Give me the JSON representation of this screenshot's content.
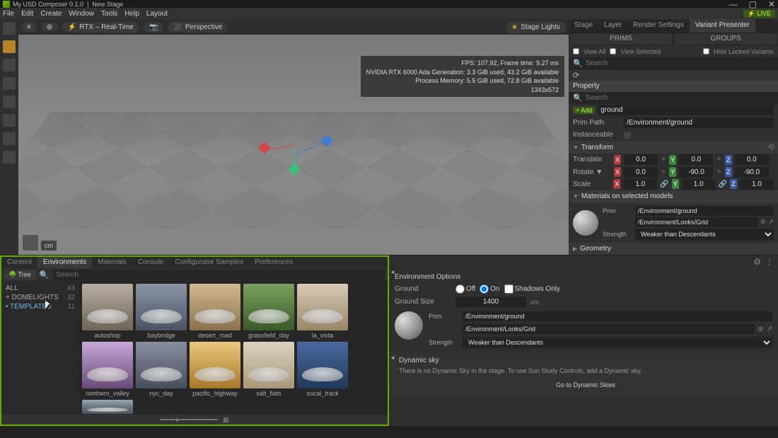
{
  "titlebar": {
    "app": "My USD Composer",
    "version": "0.1.0",
    "stage": "New Stage"
  },
  "menus": [
    "File",
    "Edit",
    "Create",
    "Window",
    "Tools",
    "Help",
    "Layout"
  ],
  "live_label": "LIVE",
  "viewport": {
    "camera_btn": "",
    "rtx_label": "RTX – Real-Time",
    "persp_label": "Perspective",
    "stage_lights": "Stage Lights",
    "stats": {
      "l1": "FPS: 107.92, Frame time: 9.27 ms",
      "l2": "NVIDIA RTX 6000 Ada Generation: 3.3 GiB used, 43.2 GiB available",
      "l3": "Process Memory: 5.5 GiB used, 72.8 GiB available",
      "l4": "1343x572"
    },
    "units": "cm"
  },
  "right": {
    "tabs": [
      "Stage",
      "Layer",
      "Render Settings",
      "Variant Presenter"
    ],
    "subtabs": [
      "PRIMS",
      "GROUPS"
    ],
    "viewall": "View All",
    "viewsel": "View Selected",
    "hidelocked": "Hide Locked Variants",
    "search_ph": "Search",
    "refresh_icon": "⟳",
    "property_title": "Property",
    "add_btn": "Add",
    "name_lbl": "",
    "name_val": "ground",
    "primpath_lbl": "Prim Path",
    "primpath_val": "/Environment/ground",
    "inst_lbl": "Instanceable",
    "transform_hdr": "Transform",
    "translate": "Translate",
    "rotate": "Rotate ▼",
    "scale": "Scale",
    "t": {
      "x": "0.0",
      "y": "0.0",
      "z": "0.0"
    },
    "r": {
      "x": "0.0",
      "y": "-90.0",
      "z": "-90.0"
    },
    "s": {
      "x": "1.0",
      "y": "1.0",
      "z": "1.0"
    },
    "materials_hdr": "Materials on selected models",
    "mat_prim_lbl": "Prim",
    "mat_prim_val": "/Environment/ground",
    "mat_path_val": "/Environment/Looks/Grid",
    "mat_strength_lbl": "Strength",
    "mat_strength_val": "Weaker than Descendants",
    "geometry_hdr": "Geometry"
  },
  "content": {
    "tabs": [
      "Content",
      "Environments",
      "Materials",
      "Console",
      "Configurator Samples",
      "Preferences"
    ],
    "tree_btn": "Tree",
    "search_ph": "Search",
    "tree": [
      {
        "name": "ALL",
        "count": "43",
        "sel": false
      },
      {
        "name": "+ DOMELIGHTS",
        "count": "32",
        "sel": false
      },
      {
        "name": "• TEMPLATES",
        "count": "11",
        "sel": true
      }
    ],
    "items_row1": [
      "autoshop",
      "baybridge",
      "desert_road",
      "grassfield_day",
      "la_vista"
    ],
    "items_row2": [
      "northern_valley",
      "nyc_day",
      "pacific_highway",
      "salt_flats",
      "socal_track"
    ]
  },
  "env": {
    "options_hdr": "Environment Options",
    "ground_lbl": "Ground",
    "ground_off": "Off",
    "ground_on": "On",
    "shadows_lbl": "Shadows Only",
    "groundsize_lbl": "Ground Size",
    "groundsize_val": "1400",
    "groundsize_unit": "cm",
    "mat_prim_lbl": "Prim",
    "mat_prim_val": "/Environment/ground",
    "mat_path_val": "/Environment/Looks/Grid",
    "mat_strength_lbl": "Strength",
    "mat_strength_val": "Weaker than Descendants",
    "dyn_hdr": "Dynamic sky",
    "dyn_msg": "There is no Dynamic Sky in the stage. To use Sun Study Controls, add a Dynamic sky.",
    "dyn_link": "Go to Dynamic Skies"
  }
}
